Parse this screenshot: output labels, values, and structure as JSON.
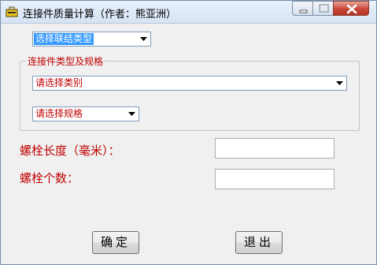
{
  "window": {
    "title": "连接件质量计算（作者：熊亚洲）"
  },
  "connection_type_select": {
    "value": "选择联结类型"
  },
  "group": {
    "label": "连接件类型及规格",
    "category_select": {
      "value": "请选择类别"
    },
    "spec_select": {
      "value": "请选择规格"
    }
  },
  "fields": {
    "bolt_length_label": "螺栓长度（毫米）：",
    "bolt_length_value": "",
    "bolt_count_label": "螺栓个数：",
    "bolt_count_value": ""
  },
  "buttons": {
    "ok": "确定",
    "exit": "退出"
  },
  "colors": {
    "label_red": "#c00000",
    "selection_blue": "#3399ff",
    "window_bg": "#f0f0f0"
  },
  "icons": {
    "app": "toolbox-icon",
    "minimize": "minimize-icon",
    "maximize": "maximize-icon",
    "close": "close-icon",
    "dropdown": "chevron-down-icon"
  }
}
